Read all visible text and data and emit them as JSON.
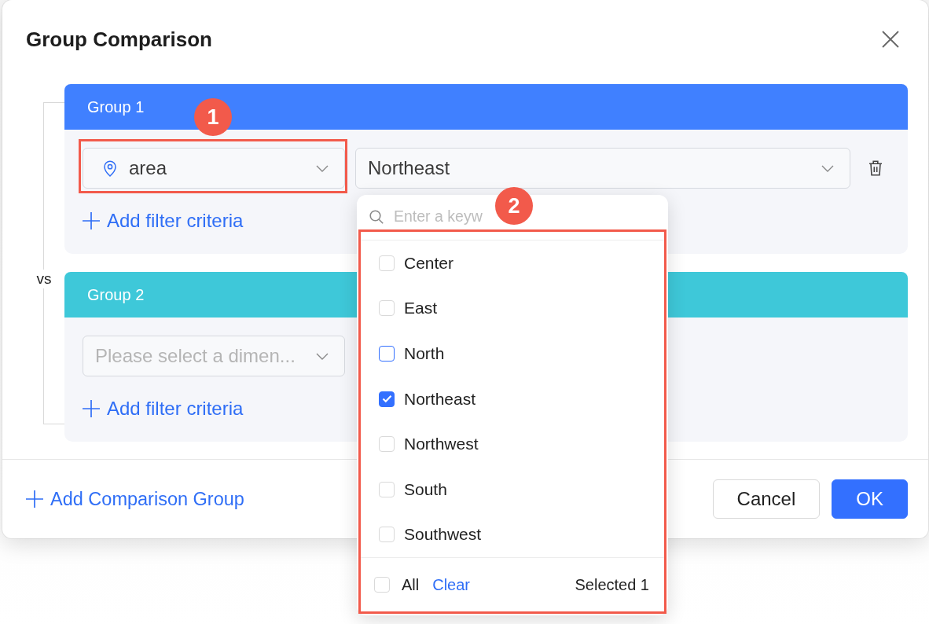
{
  "dialog": {
    "title": "Group Comparison",
    "vs_label": "vs",
    "groups": [
      {
        "title": "Group 1",
        "color": "#4080ff",
        "dimension": {
          "value": "area",
          "annotation": "1"
        },
        "value_select": {
          "value": "Northeast",
          "open": true,
          "dropdown": {
            "search_placeholder": "Enter a keyw",
            "annotation": "2",
            "options": [
              {
                "label": "Center",
                "checked": false,
                "hovered": false
              },
              {
                "label": "East",
                "checked": false,
                "hovered": false
              },
              {
                "label": "North",
                "checked": false,
                "hovered": true
              },
              {
                "label": "Northeast",
                "checked": true,
                "hovered": false
              },
              {
                "label": "Northwest",
                "checked": false,
                "hovered": false
              },
              {
                "label": "South",
                "checked": false,
                "hovered": false
              },
              {
                "label": "Southwest",
                "checked": false,
                "hovered": false
              }
            ],
            "select_all": {
              "label": "All",
              "checked": false
            },
            "clear": "Clear",
            "count": "Selected 1"
          }
        },
        "add_filter": "Add filter criteria"
      },
      {
        "title": "Group 2",
        "color": "#3ec8d9",
        "dimension": {
          "placeholder": "Please select a dimen..."
        },
        "add_filter": "Add filter criteria"
      }
    ],
    "add_group": "Add Comparison Group",
    "buttons": [
      {
        "label": "Cancel",
        "kind": "default"
      },
      {
        "label": "OK",
        "kind": "primary"
      }
    ]
  }
}
